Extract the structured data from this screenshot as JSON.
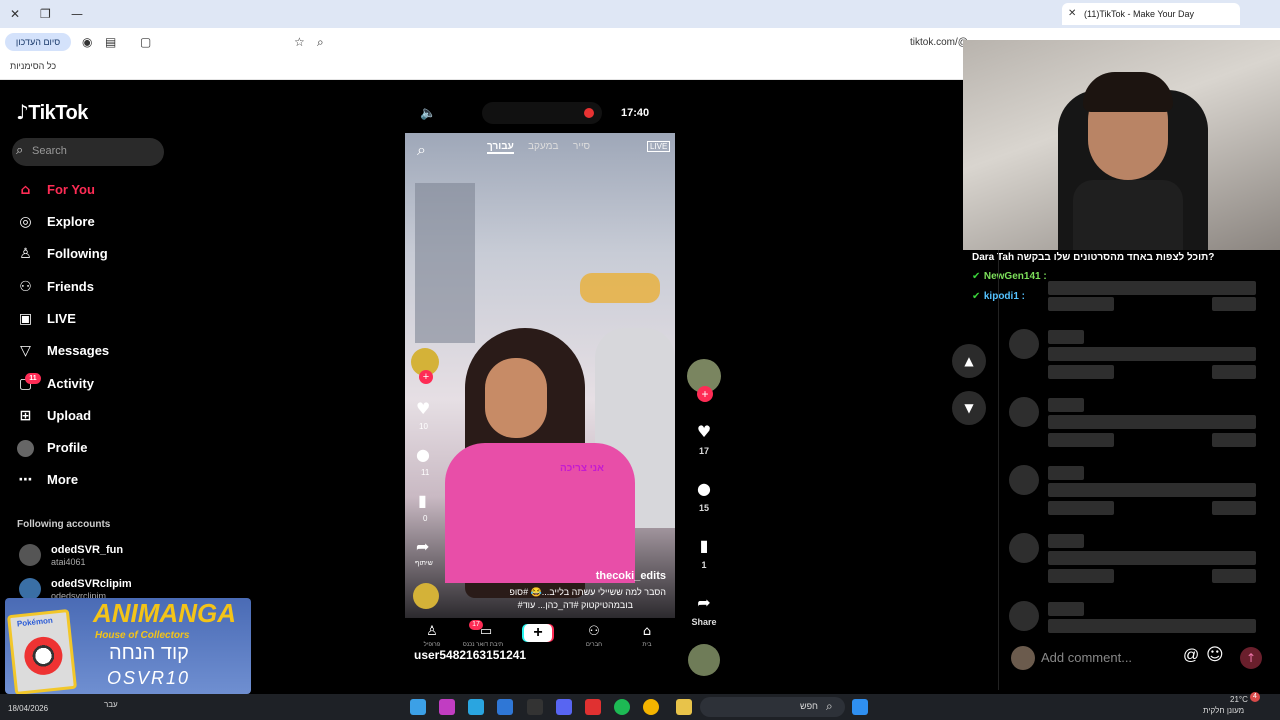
{
  "browser": {
    "tab_title": "(11)TikTok - Make Your Day",
    "finish_pill": "סיום העדכון",
    "url": "tiktok.com/@",
    "bookmarks_label": "כל הסימניות"
  },
  "sidebar": {
    "logo": "TikTok",
    "search_placeholder": "Search",
    "items": [
      {
        "label": "For You",
        "icon": "home-icon"
      },
      {
        "label": "Explore",
        "icon": "compass-icon"
      },
      {
        "label": "Following",
        "icon": "following-icon"
      },
      {
        "label": "Friends",
        "icon": "friends-icon"
      },
      {
        "label": "LIVE",
        "icon": "live-icon"
      },
      {
        "label": "Messages",
        "icon": "messages-icon"
      },
      {
        "label": "Activity",
        "icon": "activity-icon"
      },
      {
        "label": "Upload",
        "icon": "upload-icon"
      },
      {
        "label": "Profile",
        "icon": "profile-icon"
      },
      {
        "label": "More",
        "icon": "more-icon"
      }
    ],
    "activity_badge": "11",
    "following_title": "Following accounts",
    "accounts": [
      {
        "name": "odedSVR_fun",
        "handle": "atai4061"
      },
      {
        "name": "odedSVRclipim",
        "handle": "odedsvrclipim"
      }
    ]
  },
  "phone": {
    "clock": "17:40",
    "tabs": {
      "foryou": "עבורך",
      "following": "במעקב",
      "tour": "סייר"
    },
    "live": "LIVE",
    "overlay_text": "אני צריכה",
    "likes": "10",
    "comments": "11",
    "saves": "0",
    "share": "שיתוף",
    "creator": "thecoki_edits",
    "caption1": "הסבר למה ששיילי עשתה בלייב...😂 #סופ",
    "caption2": "#בובמהטיקטוק #דה_כהן... עוד",
    "username": "user5482163151241",
    "bottom": [
      {
        "label": "פרופיל"
      },
      {
        "label": "תיבת דואר נכנס",
        "badge": "17"
      },
      {
        "label": ""
      },
      {
        "label": "חברים"
      },
      {
        "label": "בית"
      }
    ]
  },
  "actions": {
    "likes": "17",
    "comments": "15",
    "saves": "1",
    "share": "Share"
  },
  "chat": {
    "msg1": "Dara Tah תוכל לצפות באחד מהסרטונים שלו בבקשה?",
    "user2": "NewGen141",
    "user3": "kipodi1"
  },
  "comments": {
    "placeholder": "Add comment...",
    "at": "@",
    "emoji": "☺",
    "send": "↑"
  },
  "overlay_logo": {
    "title": "ANIMANGA",
    "subtitle": "House of Collectors",
    "code_label": "קוד הנחה",
    "code": "OSVR10",
    "card": "Pokémon"
  },
  "taskbar": {
    "date": "18/04/2026",
    "lang": "עבר",
    "search": "חפש",
    "temp": "21°C",
    "weather": "מעונן חלקית",
    "notif": "4"
  },
  "colors": {
    "accent": "#fe2c55",
    "sidebar_bg": "#000000"
  }
}
